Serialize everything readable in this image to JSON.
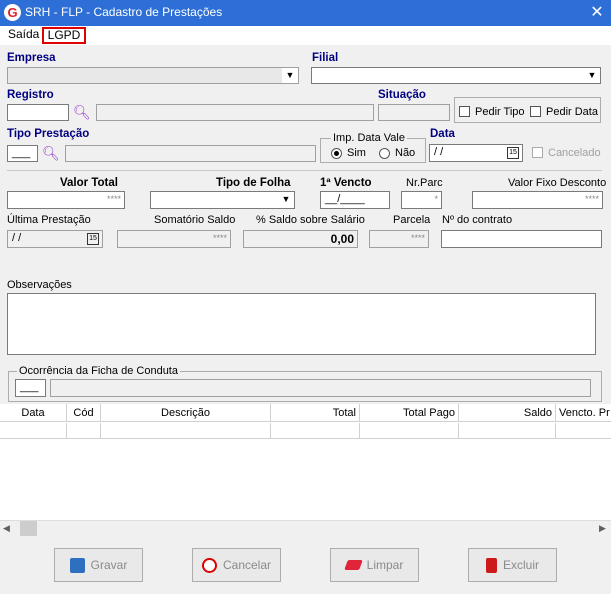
{
  "window": {
    "title": "SRH - FLP - Cadastro de Prestações",
    "app_icon_letter": "G",
    "close_glyph": "✕"
  },
  "menu": {
    "items": [
      "Saída",
      "LGPD"
    ]
  },
  "labels": {
    "empresa": "Empresa",
    "filial": "Filial",
    "registro": "Registro",
    "situacao": "Situação",
    "pedir_tipo": "Pedir Tipo",
    "pedir_data": "Pedir Data",
    "tipo_prestacao": "Tipo Prestação",
    "imp_data_vale": "Imp. Data Vale",
    "sim": "Sim",
    "nao": "Não",
    "data": "Data",
    "cancelado": "Cancelado",
    "valor_total": "Valor Total",
    "tipo_folha": "Tipo de Folha",
    "primeiro_vencto": "1ª Vencto",
    "nr_parc": "Nr.Parc",
    "valor_fixo_desconto": "Valor Fixo Desconto",
    "ultima_prestacao": "Última Prestação",
    "somatorio_saldo": "Somatório Saldo",
    "pct_saldo_salario": "% Saldo sobre Salário",
    "parcela": "Parcela",
    "nr_contrato": "Nº do contrato",
    "observacoes": "Observações",
    "ocorrencia": "Ocorrência da Ficha de Conduta"
  },
  "values": {
    "data_mask": " /  /",
    "vencto_mask": "__/____",
    "valor_mask": "****",
    "nr_parc_mask": "*",
    "ultima_prestacao": " /  /",
    "pct_saldo": "0,00",
    "tipo_prestacao_code": "___",
    "ocorrencia_code": "___"
  },
  "table": {
    "columns": [
      "Data",
      "Cód",
      "Descrição",
      "Total",
      "Total Pago",
      "Saldo",
      "Vencto. Pr"
    ]
  },
  "buttons": {
    "gravar": "Gravar",
    "cancelar": "Cancelar",
    "limpar": "Limpar",
    "excluir": "Excluir"
  },
  "colors": {
    "titlebar": "#2d6fd6",
    "label_blue": "#000080",
    "highlight_red": "#e00000",
    "search_icon": "#9a3fcf"
  },
  "icons": [
    "app-logo-icon",
    "close-icon",
    "search-icon",
    "calendar-icon",
    "chevron-down-icon",
    "save-icon",
    "cancel-icon",
    "eraser-icon",
    "trash-icon"
  ]
}
